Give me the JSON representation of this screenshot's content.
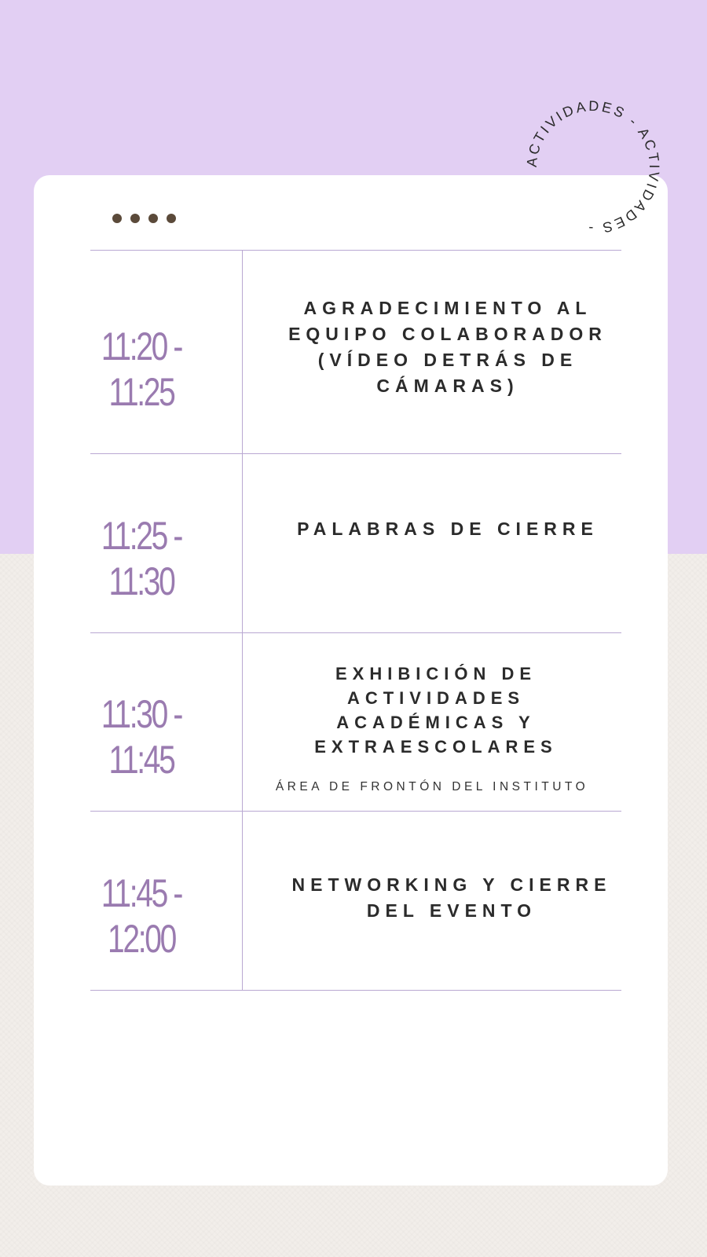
{
  "badge": {
    "text": "ACTIVIDADES - ACTIVIDADES - "
  },
  "schedule": [
    {
      "time": "11:20 - 11:25",
      "title": "AGRADECIMIENTO AL EQUIPO COLABORADOR (VÍDEO DETRÁS DE CÁMARAS)"
    },
    {
      "time": "11:25 - 11:30",
      "title": "PALABRAS DE CIERRE"
    },
    {
      "time": "11:30 - 11:45",
      "title": "EXHIBICIÓN DE ACTIVIDADES ACADÉMICAS Y EXTRAESCOLARES",
      "location": "ÁREA DE FRONTÓN DEL INSTITUTO"
    },
    {
      "time": "11:45 - 12:00",
      "title": "NETWORKING Y CIERRE DEL EVENTO"
    }
  ],
  "colors": {
    "top_background": "#e2cff3",
    "bottom_background": "#f2eeea",
    "time_text": "#9a7bb0",
    "title_text": "#2b2b2b",
    "divider": "#b9a8d2",
    "dots": "#5b4a3a"
  }
}
